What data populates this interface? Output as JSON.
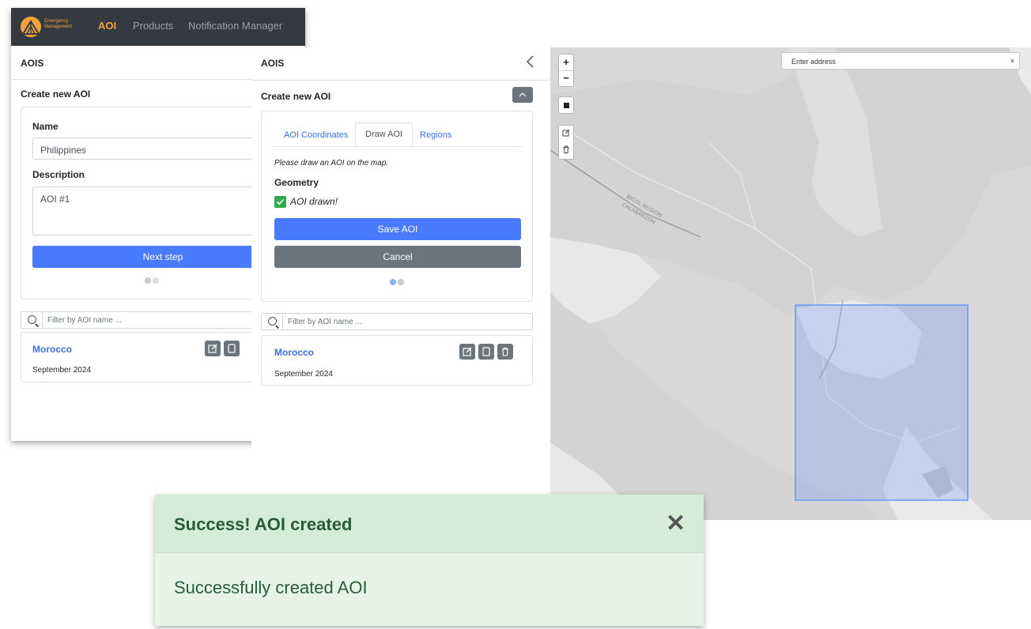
{
  "navbar": {
    "logo_text": "Emergency Management",
    "links": [
      "AOI",
      "Products",
      "Notification Manager"
    ]
  },
  "back_panel": {
    "title": "AOIS",
    "create_title": "Create new AOI",
    "name_label": "Name",
    "name_value": "Philippines",
    "description_label": "Description",
    "description_value": "AOI #1",
    "next_button": "Next step",
    "filter_placeholder": "Filter by AOI name ...",
    "item": {
      "title": "Morocco",
      "date": "September 2024"
    }
  },
  "front_panel": {
    "title": "AOIS",
    "create_title": "Create new AOI",
    "tabs": [
      "AOI Coordinates",
      "Draw AOI",
      "Regions"
    ],
    "active_tab": "Draw AOI",
    "instruction": "Please draw an AOI on the map.",
    "geometry_label": "Geometry",
    "drawn_status": "AOI drawn!",
    "save_button": "Save AOI",
    "cancel_button": "Cancel",
    "filter_placeholder": "Filter by AOI name ...",
    "item": {
      "title": "Morocco",
      "date": "September 2024"
    }
  },
  "map": {
    "zoom_in": "+",
    "zoom_out": "−",
    "address_placeholder": "Enter address",
    "address_clear": "×",
    "region_label_1": "BICOL REGION",
    "region_label_2": "CALABARZON",
    "aoi_color": "#4a7bff"
  },
  "toast": {
    "title": "Success! AOI created",
    "close": "✕",
    "message": "Successfully created AOI"
  },
  "colors": {
    "primary": "#4a7bff",
    "secondary": "#6c757d",
    "navbar": "#343a40",
    "accent": "#f2a33a",
    "success_bg": "#d5ecd7"
  }
}
